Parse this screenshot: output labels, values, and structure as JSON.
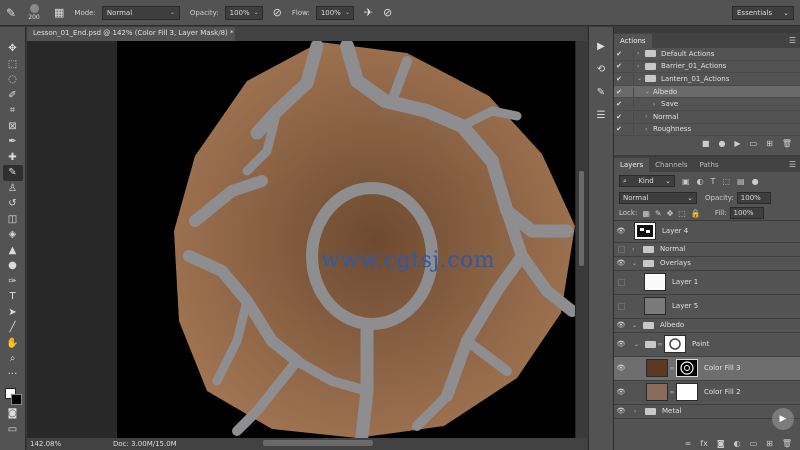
{
  "options_bar": {
    "brush_size": "200",
    "mode_label": "Mode:",
    "mode_value": "Normal",
    "opacity_label": "Opacity:",
    "opacity_value": "100%",
    "flow_label": "Flow:",
    "flow_value": "100%",
    "workspace": "Essentials"
  },
  "document": {
    "tab_title": "Lesson_01_End.psd @ 142% (Color Fill 3, Layer Mask/8) *",
    "watermark": "www.cgtsj.com",
    "zoom": "142.08%",
    "doc_size": "Doc: 3.00M/15.0M"
  },
  "actions_panel": {
    "tab": "Actions",
    "items": [
      {
        "label": "Default Actions",
        "check": "✔",
        "expand": "›",
        "folder": true
      },
      {
        "label": "Barrier_01_Actions",
        "check": "✔",
        "expand": "›",
        "folder": true
      },
      {
        "label": "Lantern_01_Actions",
        "check": "✔",
        "expand": "⌄",
        "folder": true
      },
      {
        "label": "Albedo",
        "check": "✔",
        "expand": "⌄",
        "folder": false
      },
      {
        "label": "Save",
        "check": "✔",
        "expand": "›",
        "folder": false
      },
      {
        "label": "Normal",
        "check": "✔",
        "expand": "›",
        "folder": false
      },
      {
        "label": "Roughness",
        "check": "✔",
        "expand": "›",
        "folder": false
      }
    ]
  },
  "layers_panel": {
    "tabs": [
      "Layers",
      "Channels",
      "Paths"
    ],
    "filter_kind": "Kind",
    "blend_mode": "Normal",
    "opacity_label": "Opacity:",
    "opacity_value": "100%",
    "lock_label": "Lock:",
    "fill_label": "Fill:",
    "fill_value": "100%",
    "layers": [
      {
        "name": "Layer 4"
      },
      {
        "name": "Normal"
      },
      {
        "name": "Overlays"
      },
      {
        "name": "Layer 1"
      },
      {
        "name": "Layer 5"
      },
      {
        "name": "Albedo"
      },
      {
        "name": "Paint"
      },
      {
        "name": "Color Fill 3"
      },
      {
        "name": "Color Fill 2"
      },
      {
        "name": "Metal"
      }
    ]
  },
  "colors": {
    "canvas_bg": "#000000",
    "paint_brown": "#8a6244",
    "crack_gray": "#8e8e90",
    "selection": "#6e6e6e"
  }
}
